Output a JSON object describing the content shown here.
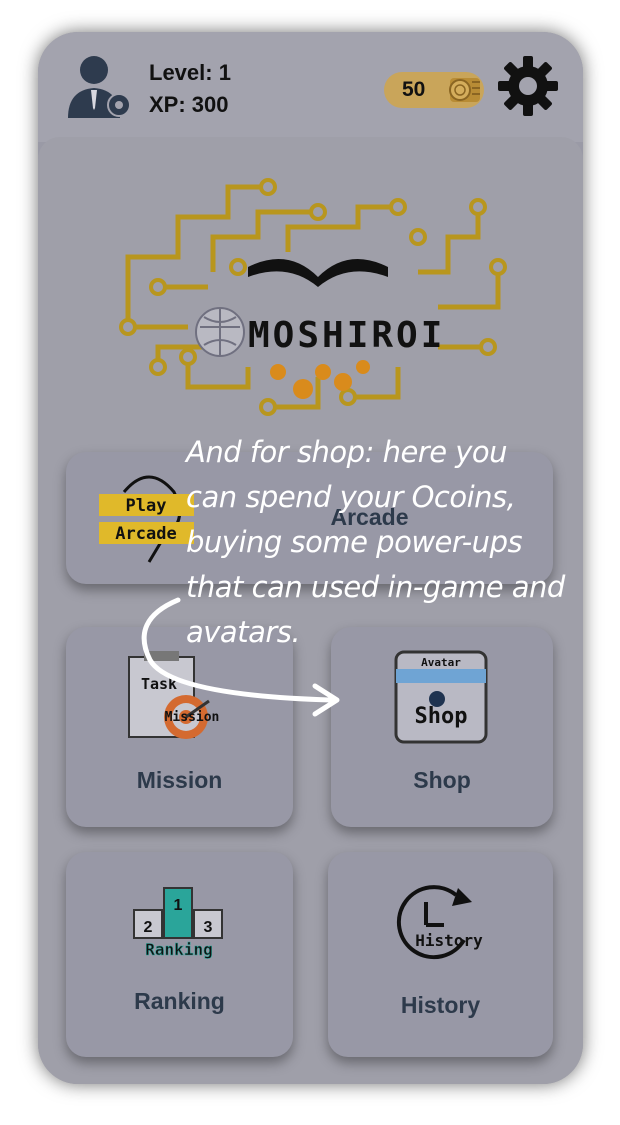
{
  "header": {
    "level_label": "Level: 1",
    "xp_label": "XP: 300",
    "coins": "50"
  },
  "logo": {
    "text": "MOSHIROI"
  },
  "menu": {
    "arcade": {
      "label": "Arcade",
      "icon_text_top": "Play",
      "icon_text_bottom": "Arcade"
    },
    "mission": {
      "label": "Mission",
      "icon_text_top": "Task",
      "icon_text_bottom": "Mission"
    },
    "shop": {
      "label": "Shop",
      "icon_text_top": "Avatar",
      "icon_text_bottom": "Shop"
    },
    "ranking": {
      "label": "Ranking",
      "icon_text": "Ranking",
      "podium": [
        "2",
        "1",
        "3"
      ]
    },
    "history": {
      "label": "History",
      "icon_text": "History"
    }
  },
  "tutorial": {
    "text": "And for shop: here you can spend your Ocoins, buying some power-ups that can used in-game and avatars."
  },
  "colors": {
    "overlay_bg": "#9a9aa6",
    "coin_pill": "#c9a55a",
    "label": "#2d3a4b",
    "tutorial_text": "#ffffff"
  }
}
